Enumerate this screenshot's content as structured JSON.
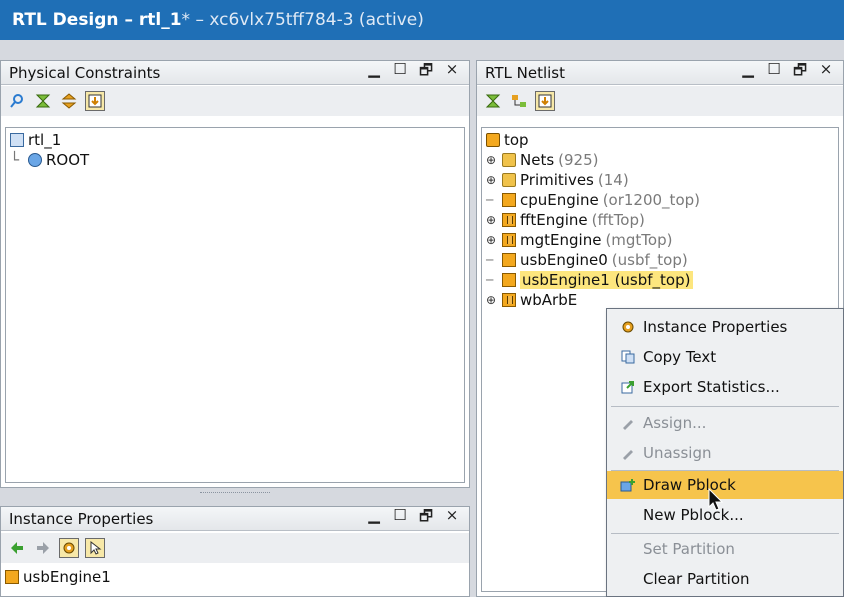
{
  "window": {
    "title_main": "RTL Design – rtl_1",
    "title_rest": " * – xc6vlx75tff784-3 (active)"
  },
  "window_controls": {
    "minimize": "▁",
    "maximize": "☐",
    "restore": "🗗",
    "close": "×"
  },
  "physical_constraints": {
    "title": "Physical Constraints",
    "tree": {
      "root": "rtl_1",
      "child": "ROOT"
    }
  },
  "rtl_netlist": {
    "title": "RTL Netlist",
    "items": [
      {
        "name": "top",
        "type": ""
      },
      {
        "name": "Nets",
        "type": "(925)"
      },
      {
        "name": "Primitives",
        "type": "(14)"
      },
      {
        "name": "cpuEngine",
        "type": "(or1200_top)"
      },
      {
        "name": "fftEngine",
        "type": "(fftTop)"
      },
      {
        "name": "mgtEngine",
        "type": "(mgtTop)"
      },
      {
        "name": "usbEngine0",
        "type": "(usbf_top)"
      },
      {
        "name": "usbEngine1",
        "type": "(usbf_top)"
      },
      {
        "name": "wbArbE",
        "type": ""
      }
    ]
  },
  "instance_properties": {
    "title": "Instance Properties",
    "selected": "usbEngine1"
  },
  "context_menu": {
    "items": [
      "Instance Properties",
      "Copy Text",
      "Export Statistics...",
      "Assign...",
      "Unassign",
      "Draw Pblock",
      "New Pblock...",
      "Set Partition",
      "Clear Partition"
    ]
  },
  "colors": {
    "title_bar": "#1f6fb6",
    "highlight": "#fde67e",
    "menu_active": "#f6c44c"
  }
}
